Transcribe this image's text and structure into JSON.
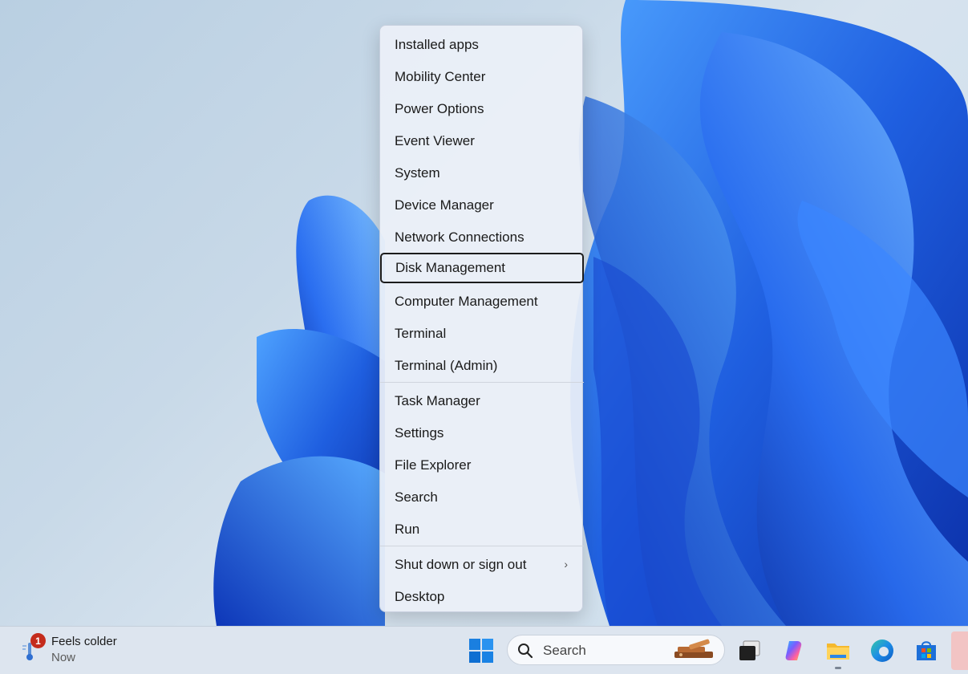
{
  "context_menu": {
    "items": [
      {
        "label": "Installed apps"
      },
      {
        "label": "Mobility Center"
      },
      {
        "label": "Power Options"
      },
      {
        "label": "Event Viewer"
      },
      {
        "label": "System"
      },
      {
        "label": "Device Manager"
      },
      {
        "label": "Network Connections"
      },
      {
        "label": "Disk Management",
        "focused": true
      },
      {
        "label": "Computer Management"
      },
      {
        "label": "Terminal"
      },
      {
        "label": "Terminal (Admin)"
      },
      {
        "label": "Task Manager"
      },
      {
        "label": "Settings"
      },
      {
        "label": "File Explorer"
      },
      {
        "label": "Search"
      },
      {
        "label": "Run"
      },
      {
        "label": "Shut down or sign out",
        "submenu_icon": "chevron-right-icon"
      },
      {
        "label": "Desktop"
      }
    ]
  },
  "taskbar": {
    "weather": {
      "title": "Feels colder",
      "subtitle": "Now",
      "badge_count": "1",
      "icon": "weather-cold-icon"
    },
    "search": {
      "label": "Search",
      "icon": "search-icon"
    },
    "pinned_apps": [
      {
        "name": "task-view-icon"
      },
      {
        "name": "copilot-icon"
      },
      {
        "name": "file-explorer-icon"
      },
      {
        "name": "edge-icon"
      },
      {
        "name": "microsoft-store-icon"
      }
    ]
  },
  "colors": {
    "badge": "#c42b1c",
    "focus_border": "#1c1c1c",
    "wallpaper_blue": "#1f5fe0"
  }
}
